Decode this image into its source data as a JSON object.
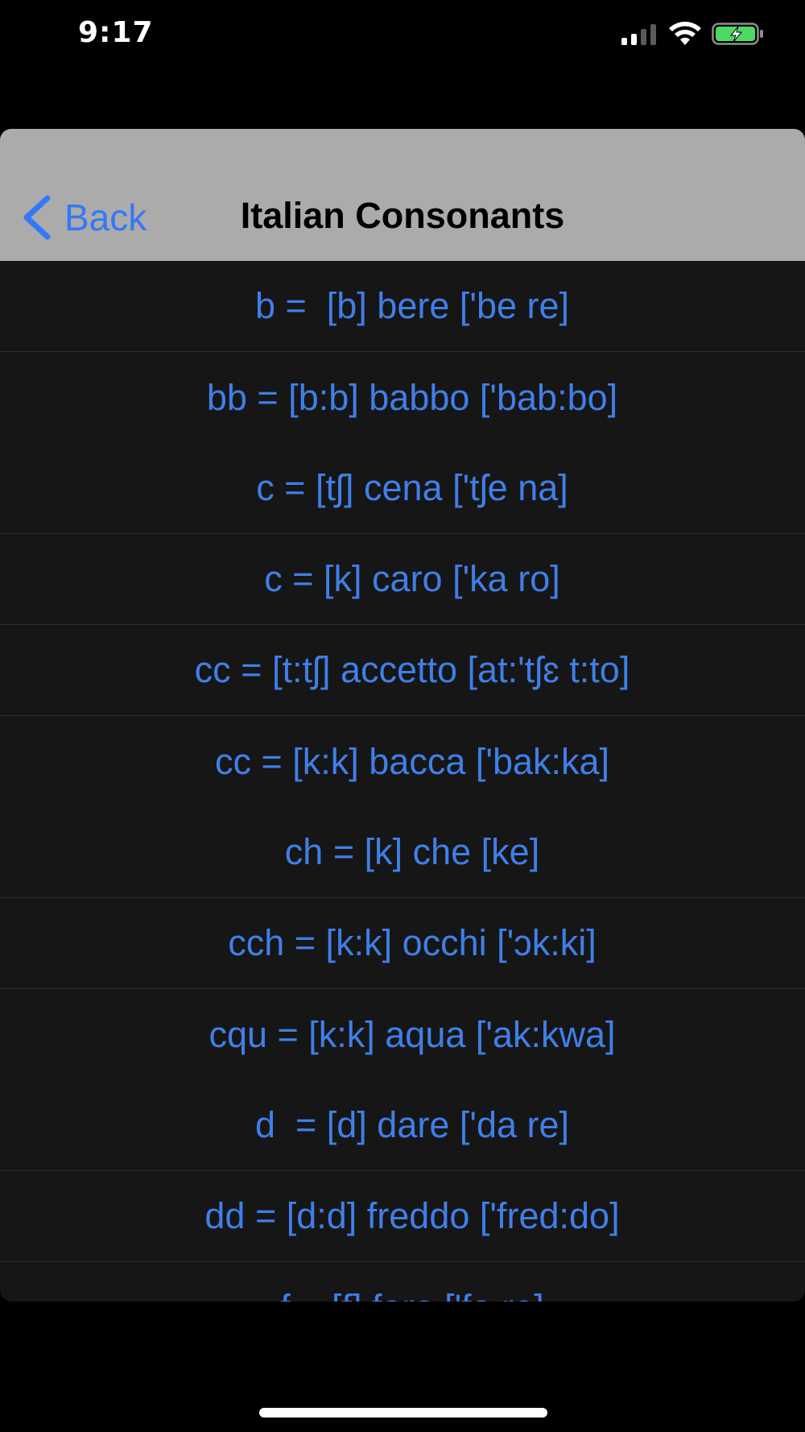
{
  "status_bar": {
    "time": "9:17",
    "signal_icon": "cellular-signal-icon",
    "wifi_icon": "wifi-icon",
    "battery_icon": "battery-charging-icon",
    "battery_color": "#4cd964"
  },
  "nav": {
    "back_label": "Back",
    "title": "Italian Consonants",
    "accent_color": "#3478f6"
  },
  "items": [
    {
      "label": "b =  [b] bere ['be re]"
    },
    {
      "label": "bb = [b:b] babbo ['bab:bo]"
    },
    {
      "label": "c = [tʃ] cena ['tʃe na]"
    },
    {
      "label": "c = [k] caro ['ka ro]"
    },
    {
      "label": "cc = [t:tʃ] accetto [at:'tʃɛ t:to]"
    },
    {
      "label": "cc = [k:k] bacca ['bak:ka]"
    },
    {
      "label": "ch = [k] che [ke]"
    },
    {
      "label": "cch = [k:k] occhi ['ɔk:ki]"
    },
    {
      "label": "cqu = [k:k] aqua ['ak:kwa]"
    },
    {
      "label": "d  = [d] dare ['da re]"
    },
    {
      "label": "dd = [d:d] freddo ['fred:do]"
    },
    {
      "label": "f = [f] fare ['fa re]"
    }
  ]
}
